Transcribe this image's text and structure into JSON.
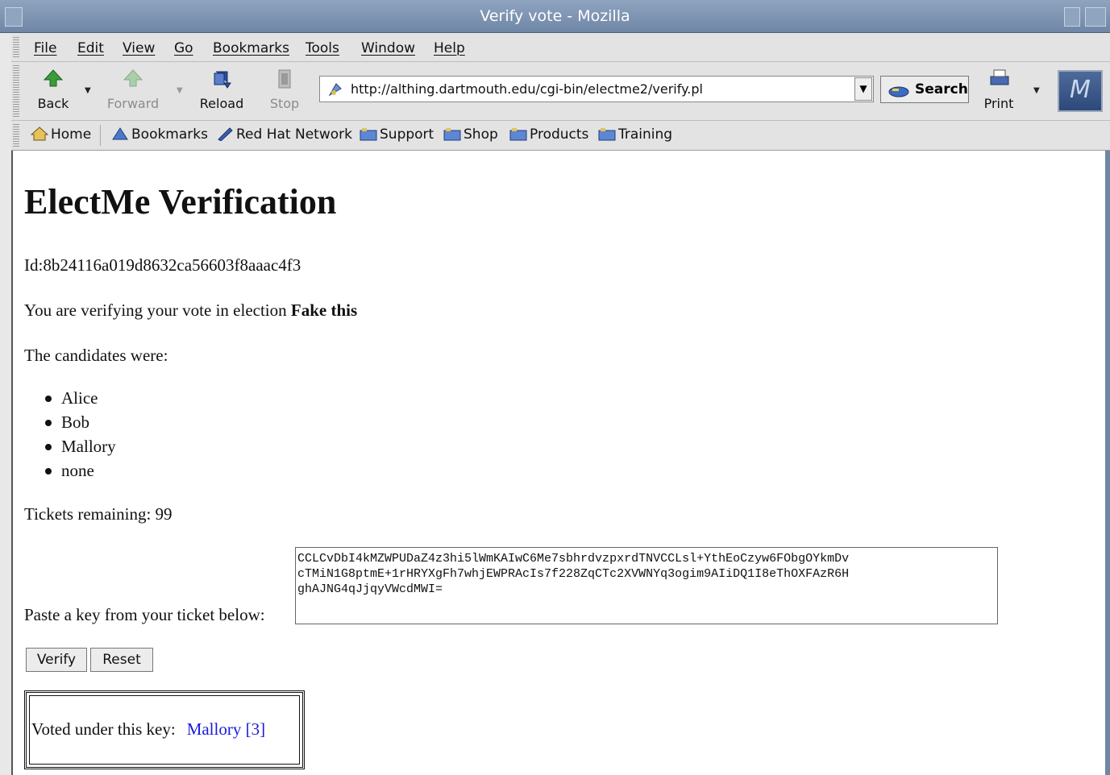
{
  "window": {
    "title": "Verify vote - Mozilla"
  },
  "menu": {
    "items": [
      "File",
      "Edit",
      "View",
      "Go",
      "Bookmarks",
      "Tools",
      "Window",
      "Help"
    ]
  },
  "navbar": {
    "back": "Back",
    "forward": "Forward",
    "reload": "Reload",
    "stop": "Stop",
    "url": "http://althing.dartmouth.edu/cgi-bin/electme2/verify.pl",
    "search": "Search",
    "print": "Print"
  },
  "personal_toolbar": {
    "items": [
      "Home",
      "Bookmarks",
      "Red Hat Network",
      "Support",
      "Shop",
      "Products",
      "Training"
    ]
  },
  "page": {
    "heading": "ElectMe Verification",
    "id_line": "Id:8b24116a019d8632ca56603f8aaac4f3",
    "verifying_prefix": "You are verifying your vote in election ",
    "election_name": "Fake this",
    "candidates_label": "The candidates were:",
    "candidates": [
      "Alice",
      "Bob",
      "Mallory",
      "none"
    ],
    "tickets_remaining": "Tickets remaining: 99",
    "paste_label": "Paste a key from your ticket below:",
    "key_value": "CCLCvDbI4kMZWPUDaZ4z3hi5lWmKAIwC6Me7sbhrdvzpxrdTNVCCLsl+YthEoCzyw6FObgOYkmDv\ncTMiN1G8ptmE+1rHRYXgFh7whjEWPRAcIs7f228ZqCTc2XVWNYq3ogim9AIiDQ1I8eThOXFAzR6H\nghAJNG4qJjqyVWcdMWI=",
    "verify_button": "Verify",
    "reset_button": "Reset",
    "voted_label": "Voted under this key:",
    "voted_value": "Mallory [3]"
  }
}
